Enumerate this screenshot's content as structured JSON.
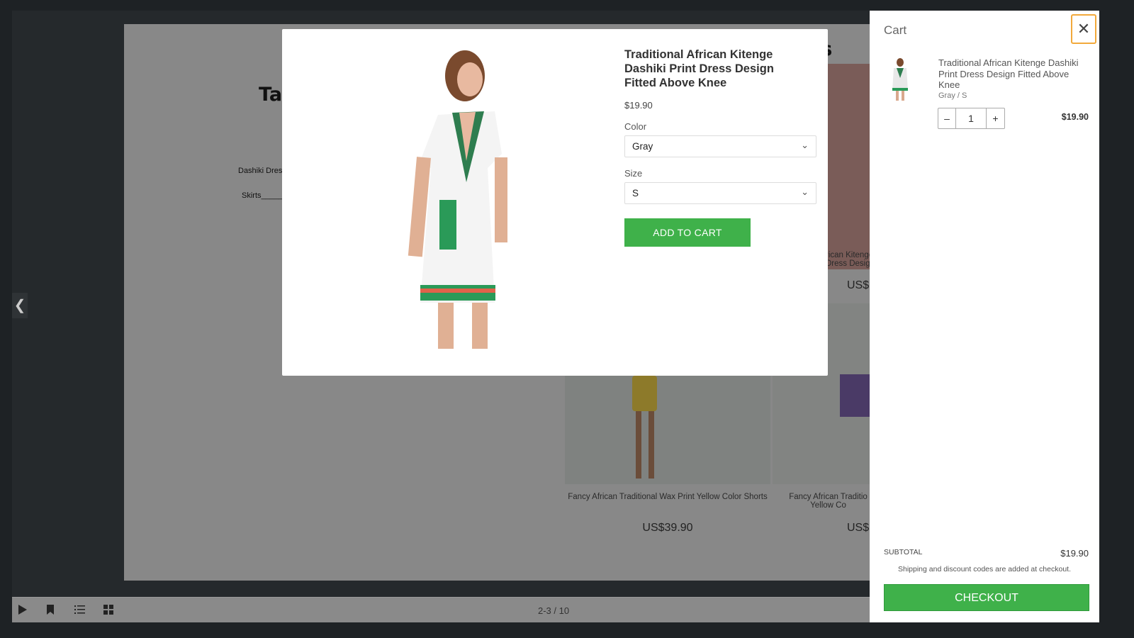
{
  "background_page": {
    "title_fragment": "Ta",
    "title_fragment_right": "es",
    "lines": [
      "Dashiki Dres",
      "Skirts______"
    ],
    "products": [
      {
        "caption": "rican Kitenge\nDress Design",
        "price": "US$"
      },
      {
        "caption": "Fancy African Traditional Wax Print Yellow Color Shorts",
        "price": "US$39.90"
      },
      {
        "caption": "Fancy African Traditio\nYellow Co",
        "price": "US$"
      }
    ]
  },
  "toolbar": {
    "pager": "2-3 / 10",
    "icons": [
      "play-icon",
      "bookmark-icon",
      "list-icon",
      "grid-icon"
    ]
  },
  "modal": {
    "title": "Traditional African Kitenge Dashiki Print Dress Design Fitted Above Knee",
    "price": "$19.90",
    "color_label": "Color",
    "color_value": "Gray",
    "size_label": "Size",
    "size_value": "S",
    "add_to_cart": "ADD TO CART"
  },
  "cart": {
    "title": "Cart",
    "item": {
      "name": "Traditional African Kitenge Dashiki Print Dress Design Fitted Above Knee",
      "variant": "Gray / S",
      "quantity": "1",
      "price": "$19.90"
    },
    "subtotal_label": "SUBTOTAL",
    "subtotal_value": "$19.90",
    "shipping_note": "Shipping and discount codes are added at checkout.",
    "checkout": "CHECKOUT"
  },
  "colors": {
    "accent_green": "#3fb14a",
    "focus_orange": "#f2a93b"
  }
}
